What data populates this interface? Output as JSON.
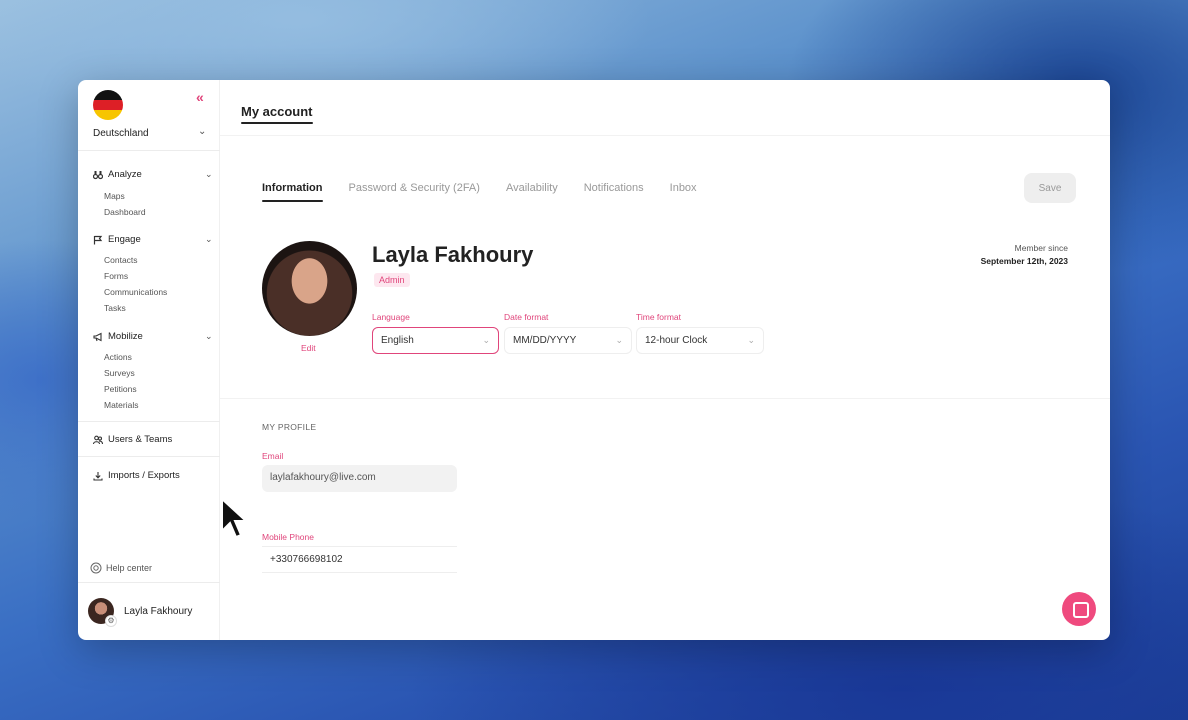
{
  "sidebar": {
    "country": "Deutschland",
    "collapse_icon": "«",
    "sections": [
      {
        "label": "Analyze",
        "icon": "binoculars-icon",
        "items": [
          "Maps",
          "Dashboard"
        ]
      },
      {
        "label": "Engage",
        "icon": "flag-icon",
        "items": [
          "Contacts",
          "Forms",
          "Communications",
          "Tasks"
        ]
      },
      {
        "label": "Mobilize",
        "icon": "megaphone-icon",
        "items": [
          "Actions",
          "Surveys",
          "Petitions",
          "Materials"
        ]
      }
    ],
    "users_teams": "Users & Teams",
    "imports_exports": "Imports / Exports",
    "help_center": "Help center",
    "user_name": "Layla Fakhoury"
  },
  "header": {
    "title": "My account"
  },
  "tabs": [
    {
      "label": "Information",
      "active": true
    },
    {
      "label": "Password & Security (2FA)",
      "active": false
    },
    {
      "label": "Availability",
      "active": false
    },
    {
      "label": "Notifications",
      "active": false
    },
    {
      "label": "Inbox",
      "active": false
    }
  ],
  "save_label": "Save",
  "profile": {
    "name": "Layla Fakhoury",
    "role": "Admin",
    "edit_label": "Edit",
    "member_since_label": "Member since",
    "member_since_date": "September 12th, 2023"
  },
  "preferences": {
    "language_label": "Language",
    "language_value": "English",
    "date_format_label": "Date format",
    "date_format_value": "MM/DD/YYYY",
    "time_format_label": "Time format",
    "time_format_value": "12-hour Clock"
  },
  "my_profile": {
    "heading": "MY PROFILE",
    "email_label": "Email",
    "email_value": "laylafakhoury@live.com",
    "phone_label": "Mobile Phone",
    "phone_value": "+330766698102"
  },
  "colors": {
    "accent": "#e0457b",
    "chat_button": "#ef4a7e"
  }
}
